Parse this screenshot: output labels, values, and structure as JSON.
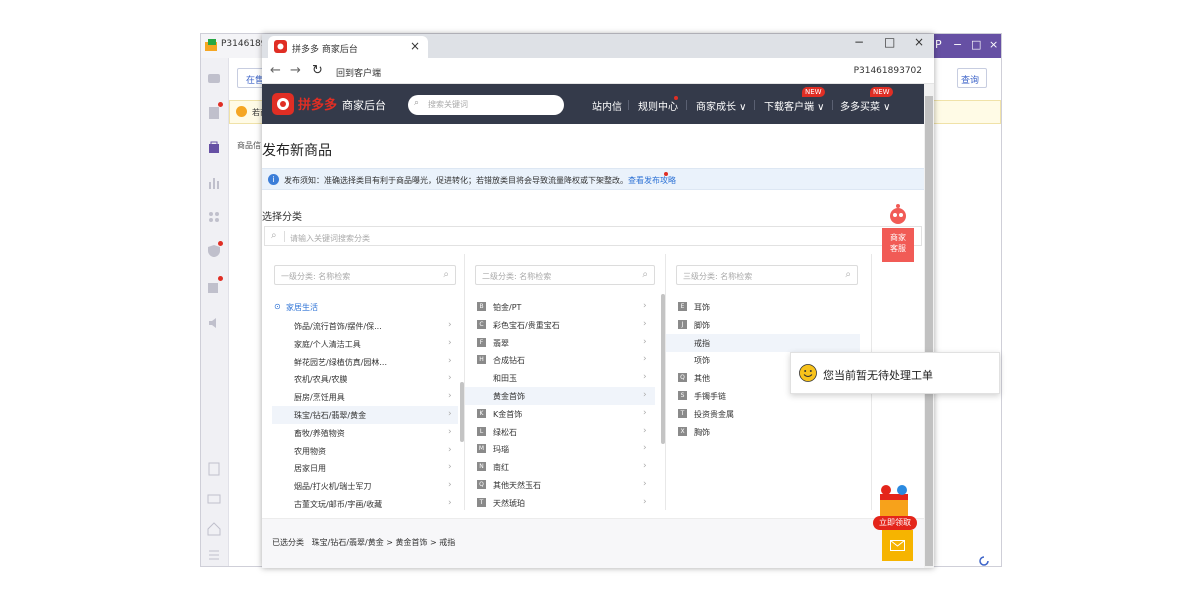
{
  "background_app": {
    "title": "P31461893",
    "partial_button": "在售",
    "query_button": "查询",
    "tab_hint": "商品信",
    "notice_hint": "若商"
  },
  "browser": {
    "tab_title": "拼多多 商家后台",
    "tab_close": "×",
    "back_to_client": "回到客户端",
    "account_id": "P31461893702",
    "window_controls": [
      "−",
      "□",
      "×"
    ]
  },
  "header": {
    "logo_text": "拼多多",
    "subtitle": "商家后台",
    "search_placeholder": "搜索关键词",
    "nav": [
      {
        "label": "站内信"
      },
      {
        "label": "规则中心"
      },
      {
        "label": "商家成长 ∨"
      },
      {
        "label": "下载客户端 ∨",
        "badge": "NEW"
      },
      {
        "label": "多多买菜 ∨",
        "badge": "NEW"
      }
    ]
  },
  "page": {
    "title": "发布新商品",
    "notice_text": "发布须知：准确选择类目有利于商品曝光，促进转化；若错放类目将会导致流量降权或下架整改。",
    "notice_link": "查看发布攻略",
    "section_label": "选择分类",
    "category_search_placeholder": "请输入关键词搜索分类"
  },
  "columns": {
    "level1": {
      "placeholder": "一级分类: 名称检索",
      "group_label": "家居生活",
      "items": [
        {
          "label": "饰品/流行首饰/摆件/保...",
          "selected": false
        },
        {
          "label": "家庭/个人清洁工具",
          "selected": false
        },
        {
          "label": "鲜花园艺/绿植仿真/园林...",
          "selected": false
        },
        {
          "label": "农机/农具/农膜",
          "selected": false
        },
        {
          "label": "厨房/烹饪用具",
          "selected": false
        },
        {
          "label": "珠宝/钻石/翡翠/黄金",
          "selected": true
        },
        {
          "label": "畜牧/养殖物资",
          "selected": false
        },
        {
          "label": "农用物资",
          "selected": false
        },
        {
          "label": "居家日用",
          "selected": false
        },
        {
          "label": "烟品/打火机/瑞士军刀",
          "selected": false
        },
        {
          "label": "古董文玩/邮币/字画/收藏",
          "selected": false
        }
      ]
    },
    "level2": {
      "placeholder": "二级分类: 名称检索",
      "items": [
        {
          "letter": "B",
          "label": "铂金/PT",
          "selected": false
        },
        {
          "letter": "C",
          "label": "彩色宝石/贵重宝石",
          "selected": false
        },
        {
          "letter": "F",
          "label": "翡翠",
          "selected": false
        },
        {
          "letter": "H",
          "label": "合成钻石",
          "selected": false
        },
        {
          "letter": "",
          "label": "和田玉",
          "selected": false
        },
        {
          "letter": "",
          "label": "黄金首饰",
          "selected": true
        },
        {
          "letter": "K",
          "label": "K金首饰",
          "selected": false
        },
        {
          "letter": "L",
          "label": "绿松石",
          "selected": false
        },
        {
          "letter": "M",
          "label": "玛瑙",
          "selected": false
        },
        {
          "letter": "N",
          "label": "南红",
          "selected": false
        },
        {
          "letter": "Q",
          "label": "其他天然玉石",
          "selected": false
        },
        {
          "letter": "T",
          "label": "天然琥珀",
          "selected": false
        }
      ]
    },
    "level3": {
      "placeholder": "三级分类: 名称检索",
      "items": [
        {
          "letter": "E",
          "label": "耳饰",
          "selected": false
        },
        {
          "letter": "J",
          "label": "脚饰",
          "selected": false
        },
        {
          "letter": "",
          "label": "戒指",
          "selected": true
        },
        {
          "letter": "",
          "label": "项饰",
          "selected": false
        },
        {
          "letter": "Q",
          "label": "其他",
          "selected": false
        },
        {
          "letter": "S",
          "label": "手镯手链",
          "selected": false
        },
        {
          "letter": "T",
          "label": "投资贵金属",
          "selected": false
        },
        {
          "letter": "X",
          "label": "胸饰",
          "selected": false
        }
      ]
    }
  },
  "selected": {
    "label": "已选分类",
    "path": "珠宝/钻石/翡翠/黄金 > 黄金首饰 > 戒指"
  },
  "widgets": {
    "customer_service": "商家\n客服",
    "promo_label": "立即领取"
  },
  "toast": {
    "text": "您当前暂无待处理工单"
  },
  "colors": {
    "header_bg": "#343a4a",
    "brand_red": "#e02e24",
    "link_blue": "#2e73d6",
    "selected_row": "#f0f4fa",
    "bg_app_accent": "#6650a4"
  }
}
